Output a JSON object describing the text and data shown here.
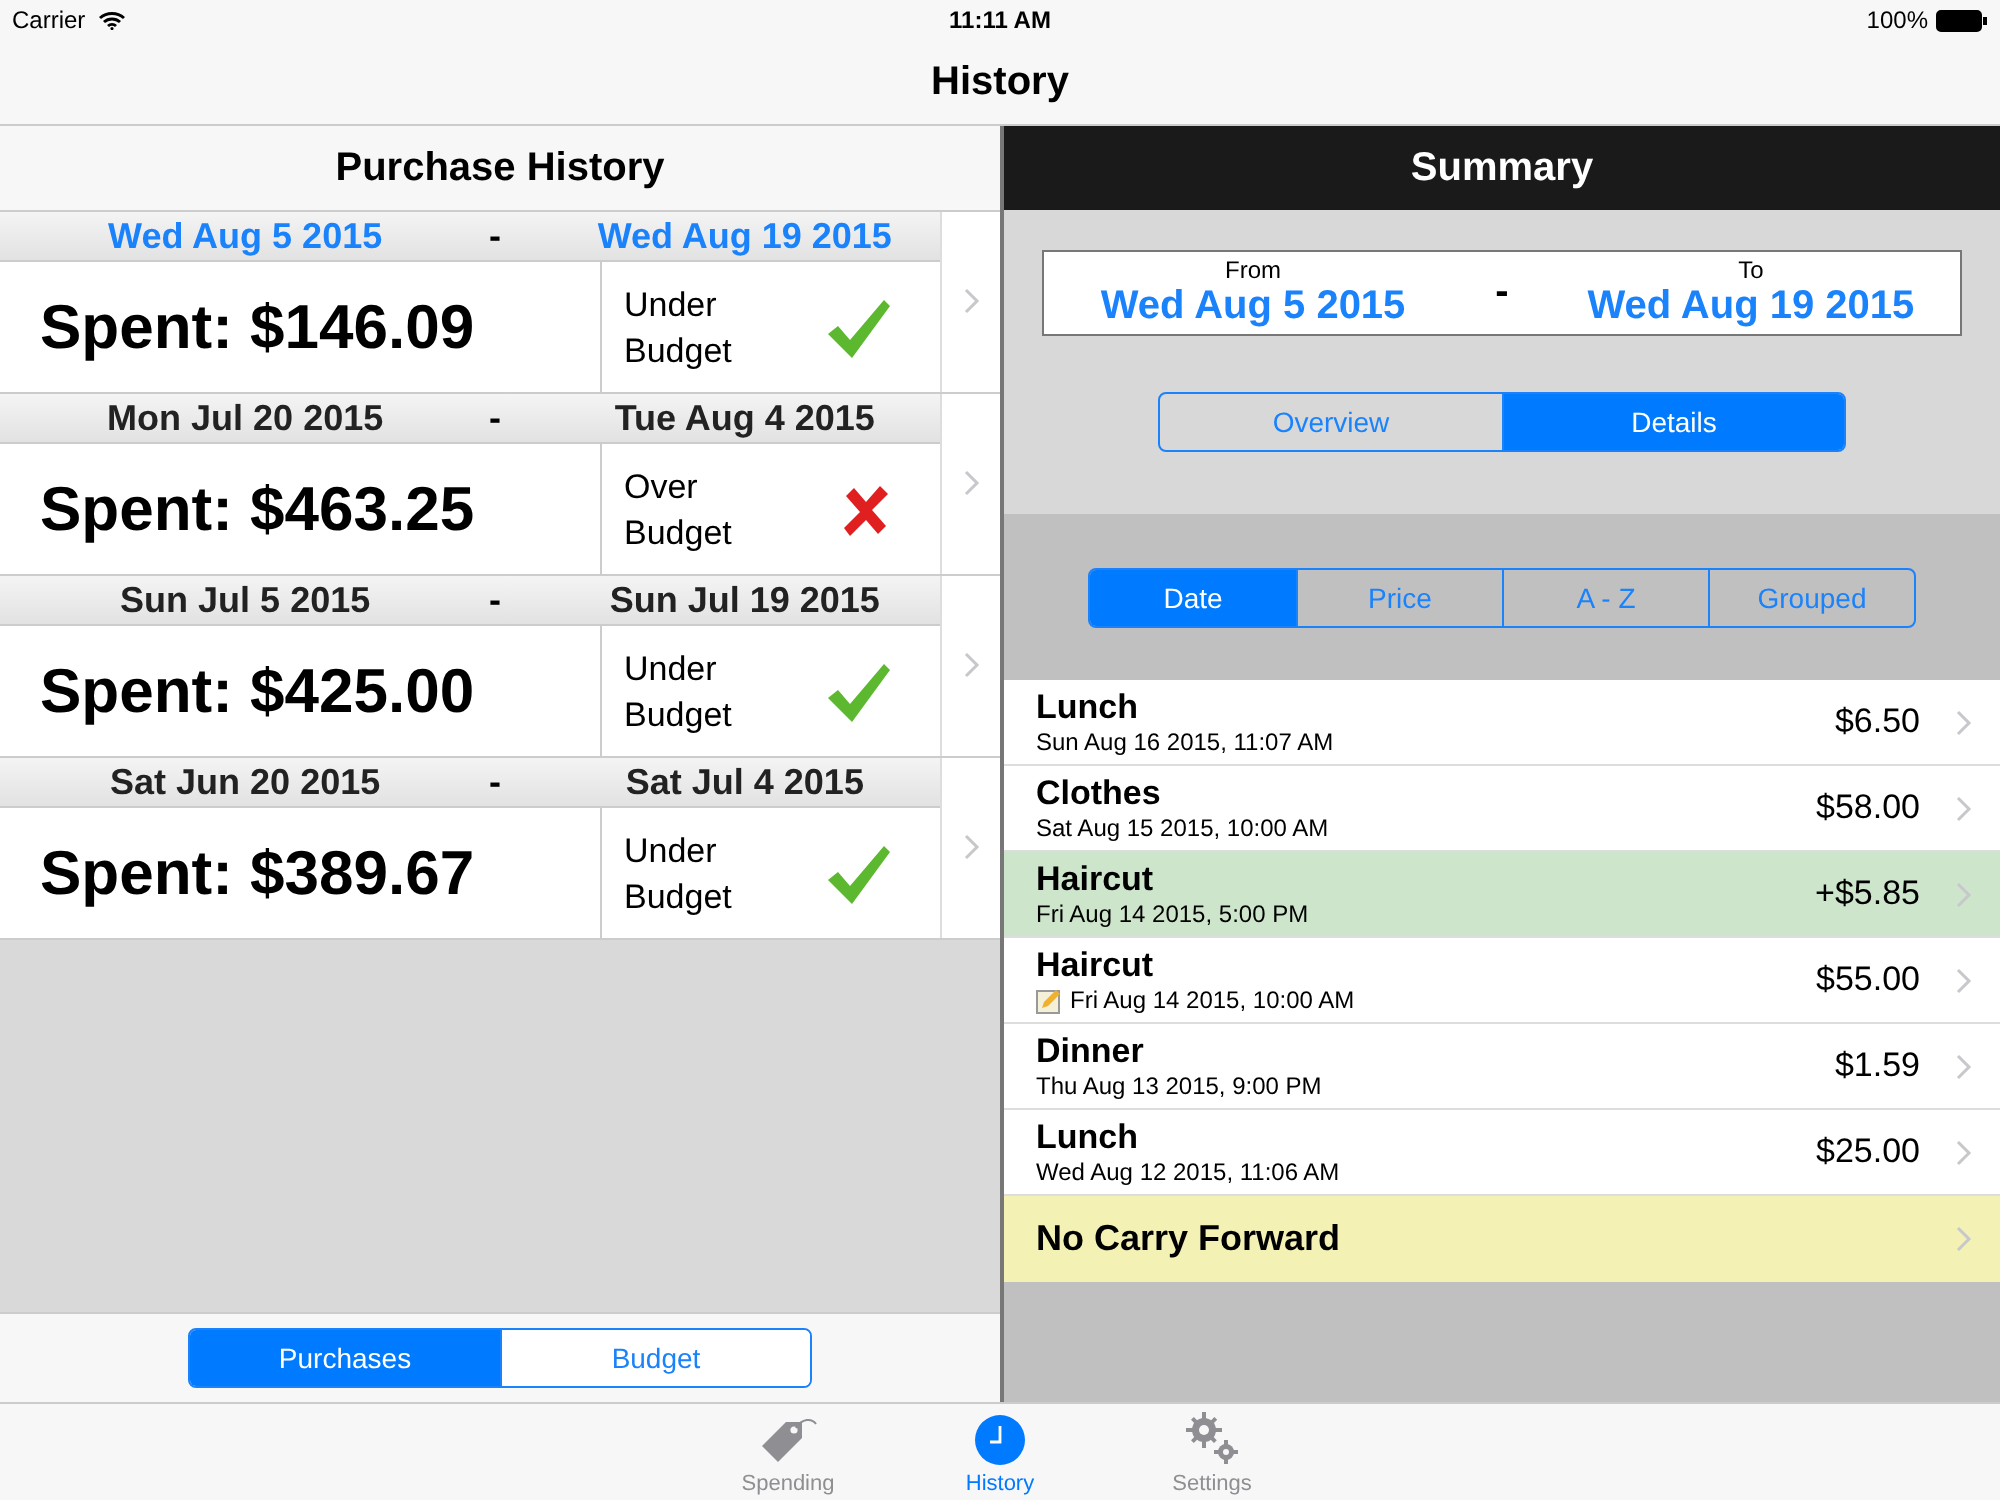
{
  "status_bar": {
    "carrier": "Carrier",
    "time": "11:11 AM",
    "battery": "100%"
  },
  "nav_title": "History",
  "left": {
    "title": "Purchase History",
    "periods": [
      {
        "start": "Wed Aug 5 2015",
        "end": "Wed Aug 19 2015",
        "current": true,
        "spent": "Spent: $146.09",
        "status_line1": "Under",
        "status_line2": "Budget",
        "kind": "under"
      },
      {
        "start": "Mon Jul 20 2015",
        "end": "Tue Aug 4 2015",
        "current": false,
        "spent": "Spent: $463.25",
        "status_line1": "Over",
        "status_line2": "Budget",
        "kind": "over"
      },
      {
        "start": "Sun Jul 5 2015",
        "end": "Sun Jul 19 2015",
        "current": false,
        "spent": "Spent: $425.00",
        "status_line1": "Under",
        "status_line2": "Budget",
        "kind": "under"
      },
      {
        "start": "Sat Jun 20 2015",
        "end": "Sat Jul 4 2015",
        "current": false,
        "spent": "Spent: $389.67",
        "status_line1": "Under",
        "status_line2": "Budget",
        "kind": "under"
      }
    ],
    "separator": "-",
    "segments": [
      {
        "label": "Purchases",
        "selected": true
      },
      {
        "label": "Budget",
        "selected": false
      }
    ]
  },
  "right": {
    "title": "Summary",
    "from_label": "From",
    "to_label": "To",
    "from": "Wed Aug 5 2015",
    "to": "Wed Aug 19 2015",
    "separator": "-",
    "view_segments": [
      {
        "label": "Overview",
        "selected": false
      },
      {
        "label": "Details",
        "selected": true
      }
    ],
    "sort_segments": [
      {
        "label": "Date",
        "selected": true
      },
      {
        "label": "Price",
        "selected": false
      },
      {
        "label": "A - Z",
        "selected": false
      },
      {
        "label": "Grouped",
        "selected": false
      }
    ],
    "purchases": [
      {
        "name": "Lunch",
        "date": "Sun Aug 16 2015, 11:07 AM",
        "amount": "$6.50",
        "kind": "purchase",
        "has_note": false
      },
      {
        "name": "Clothes",
        "date": "Sat Aug 15 2015, 10:00 AM",
        "amount": "$58.00",
        "kind": "purchase",
        "has_note": false
      },
      {
        "name": "Haircut",
        "date": "Fri Aug 14 2015, 5:00 PM",
        "amount": "+$5.85",
        "kind": "refund",
        "has_note": false
      },
      {
        "name": "Haircut",
        "date": "Fri Aug 14 2015, 10:00 AM",
        "amount": "$55.00",
        "kind": "purchase",
        "has_note": true
      },
      {
        "name": "Dinner",
        "date": "Thu Aug 13 2015, 9:00 PM",
        "amount": "$1.59",
        "kind": "purchase",
        "has_note": false
      },
      {
        "name": "Lunch",
        "date": "Wed Aug 12 2015, 11:06 AM",
        "amount": "$25.00",
        "kind": "purchase",
        "has_note": false
      }
    ],
    "carry_forward": "No Carry Forward"
  },
  "tab_bar": [
    {
      "label": "Spending",
      "kind": "tag",
      "selected": false
    },
    {
      "label": "History",
      "kind": "clock",
      "selected": true
    },
    {
      "label": "Settings",
      "kind": "gears",
      "selected": false
    }
  ]
}
